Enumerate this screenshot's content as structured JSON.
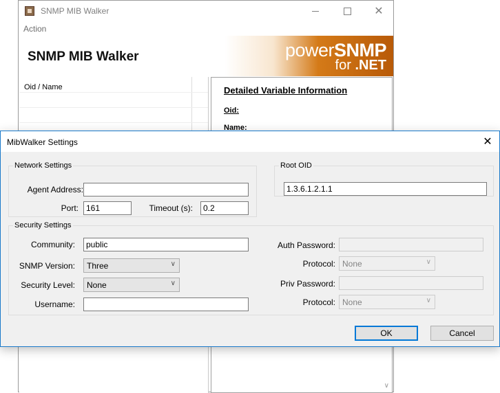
{
  "main_window": {
    "title": "SNMP MIB Walker",
    "menu": {
      "action": "Action"
    },
    "banner_title": "SNMP MIB Walker",
    "logo": {
      "power": "power",
      "snmp": "SNMP",
      "for": "for",
      "net": ".NET"
    },
    "tree_header": "Oid / Name",
    "details": {
      "heading": "Detailed Variable Information",
      "oid_label": "Oid:",
      "name_label": "Name:"
    }
  },
  "dialog": {
    "title": "MibWalker Settings",
    "network": {
      "legend": "Network Settings",
      "agent_address_label": "Agent Address:",
      "agent_address_value": "",
      "port_label": "Port:",
      "port_value": "161",
      "timeout_label": "Timeout (s):",
      "timeout_value": "0.2"
    },
    "root": {
      "legend": "Root OID",
      "value": "1.3.6.1.2.1.1"
    },
    "security": {
      "legend": "Security Settings",
      "community_label": "Community:",
      "community_value": "public",
      "version_label": "SNMP Version:",
      "version_value": "Three",
      "level_label": "Security Level:",
      "level_value": "None",
      "username_label": "Username:",
      "username_value": "",
      "auth_password_label": "Auth Password:",
      "auth_password_value": "",
      "auth_protocol_label": "Protocol:",
      "auth_protocol_value": "None",
      "priv_password_label": "Priv Password:",
      "priv_password_value": "",
      "priv_protocol_label": "Protocol:",
      "priv_protocol_value": "None"
    },
    "buttons": {
      "ok": "OK",
      "cancel": "Cancel"
    }
  },
  "icons": {
    "close": "close-icon",
    "minimize": "minimize-icon",
    "maximize": "maximize-icon",
    "dropdown": "chevron-down-icon"
  }
}
